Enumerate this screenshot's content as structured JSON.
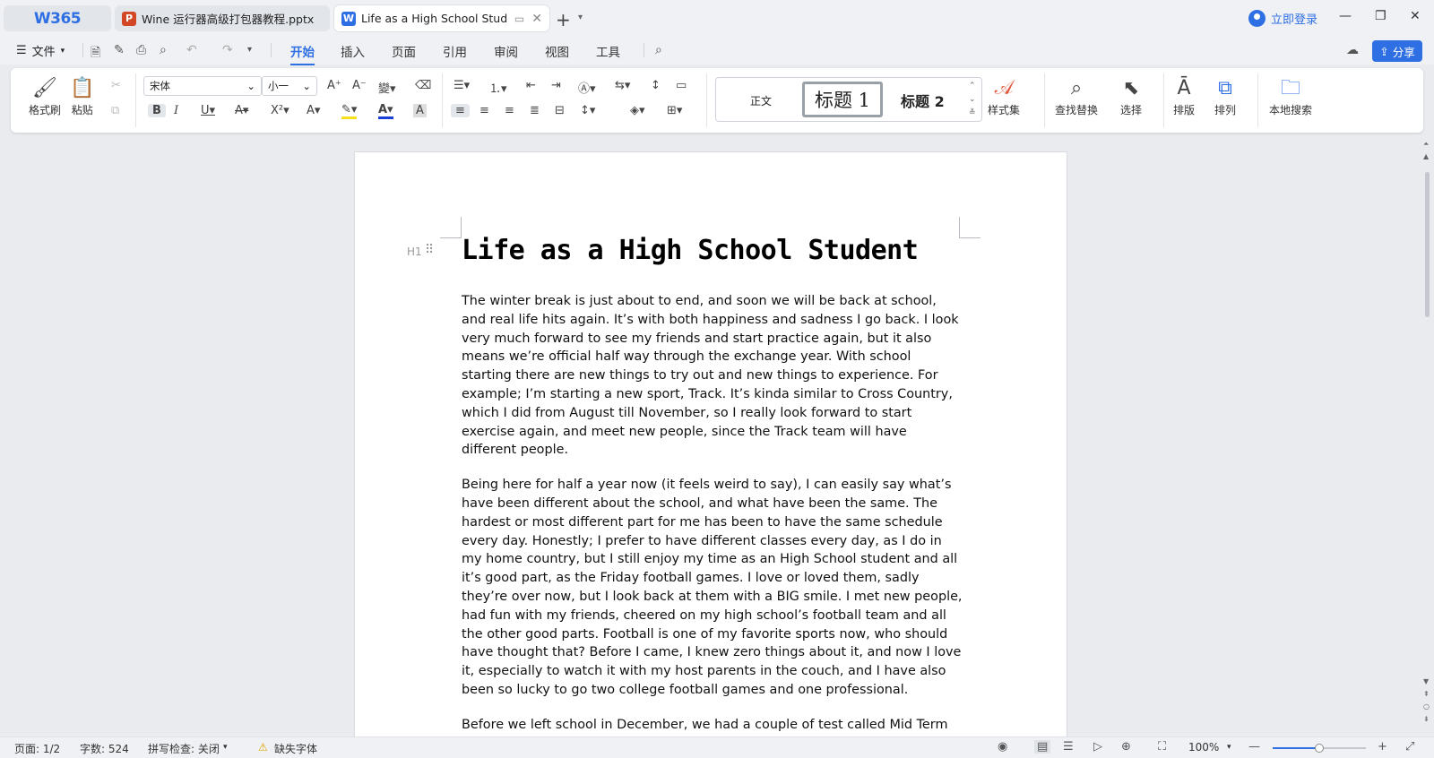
{
  "tabbar": {
    "logo": "W365",
    "tabs": [
      {
        "icon": "P",
        "title": "Wine 运行器高级打包器教程.pptx"
      },
      {
        "icon": "W",
        "title": "Life as a High School Student"
      }
    ],
    "login": "立即登录"
  },
  "menu": {
    "file": "文件",
    "tabs": [
      "开始",
      "插入",
      "页面",
      "引用",
      "审阅",
      "视图",
      "工具"
    ],
    "active_tab": "开始",
    "share": "分享"
  },
  "ribbon": {
    "format_painter": "格式刷",
    "paste": "粘贴",
    "font_name": "宋体",
    "font_size": "小一",
    "styles": {
      "normal": "正文",
      "h1": "标题 1",
      "h2": "标题 2"
    },
    "style_set": "样式集",
    "find_replace": "查找替换",
    "select": "选择",
    "layout": "排版",
    "arrange": "排列",
    "local_search": "本地搜索"
  },
  "document": {
    "heading_marker": "H1",
    "title": "Life as a High School Student",
    "paragraphs": [
      "The winter break is just about to end, and soon we will be back at school, and real life hits again. It’s with both happiness and sadness I go back. I look very much forward to see my friends and start practice again, but it also means we’re official half way through the exchange year. With school starting there are new things to try out and new things to experience. For example; I’m starting a new sport, Track. It’s kinda similar to Cross Country, which I did from August till November, so I really look forward to start exercise again, and meet new people, since the Track team will have different people.",
      "Being here for half a year now (it feels weird to say), I can easily say what’s have been different about the school, and what have been the same. The hardest or most different part for me has been to have the same schedule every day. Honestly; I prefer to have different classes every day, as I do in my home country, but I still enjoy my time as an High School student and all it’s good part, as the Friday football games. I love or loved them, sadly they’re over now, but I look back at them with a BIG smile. I met new people, had fun with my friends, cheered on my high school’s football team and all the other good parts. Football is one of my favorite sports now, who should have thought that? Before I came, I knew zero things about it, and now I love it, especially to watch it with my host parents in the couch, and I have also been so lucky to go two college football games and one professional.",
      "Before we left school in December, we had a couple of test called Mid Term test. It’s up to the single teacher if he or she will give you at test, but most of them do. This is one of the first times I felt a lot of pressure to do well."
    ]
  },
  "status": {
    "page": "页面: 1/2",
    "words": "字数: 524",
    "spell": "拼写检查: 关闭",
    "missing_font": "缺失字体",
    "zoom": "100%",
    "zoom_level": 0.5
  }
}
